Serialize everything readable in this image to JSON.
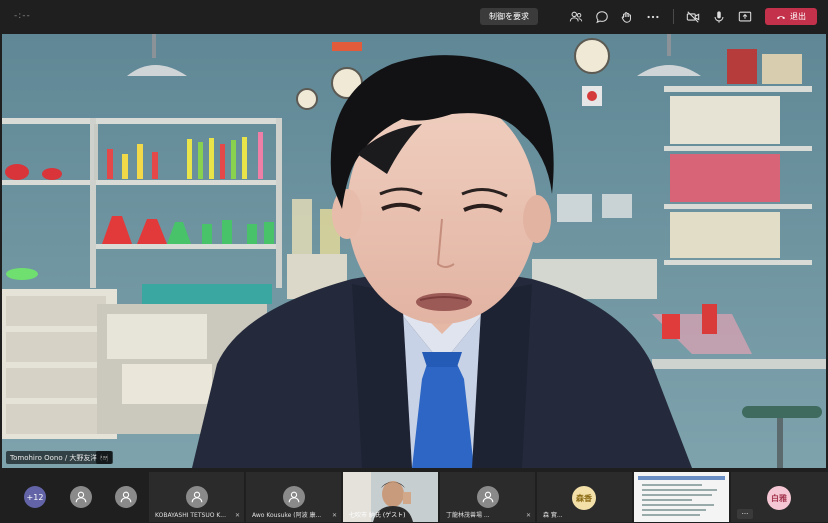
{
  "topbar": {
    "timer": "-:--",
    "request_control_label": "制御を要求",
    "leave_label": "退出",
    "icons": [
      "participants-icon",
      "chat-icon",
      "reactions-icon",
      "more-icon",
      "camera-off-icon",
      "mic-icon",
      "share-icon",
      "phone-icon"
    ],
    "leave_color": "#c4314b"
  },
  "main_video": {
    "speaker_name": "Tomohiro Oono / 大野友洋 (aj",
    "more_label": "···"
  },
  "gallery": {
    "more_count": "+12",
    "tiles": [
      {
        "label": "KOBAYASHI TETSUO K..."
      },
      {
        "label": "Awo Kousuke (阿波 康..."
      },
      {
        "label": "七吹市 納氏 (ゲスト)"
      },
      {
        "label": "丁龍林茂兽場 ..."
      },
      {
        "label": "森 實..."
      },
      {
        "label": ""
      },
      {
        "label": ""
      }
    ],
    "initials": [
      {
        "text": "森香",
        "bg": "#f3e0a8",
        "fg": "#8a6a14"
      },
      {
        "text": "白雅",
        "bg": "#f5c6d3",
        "fg": "#a3364f"
      }
    ],
    "tile_more": "···"
  }
}
